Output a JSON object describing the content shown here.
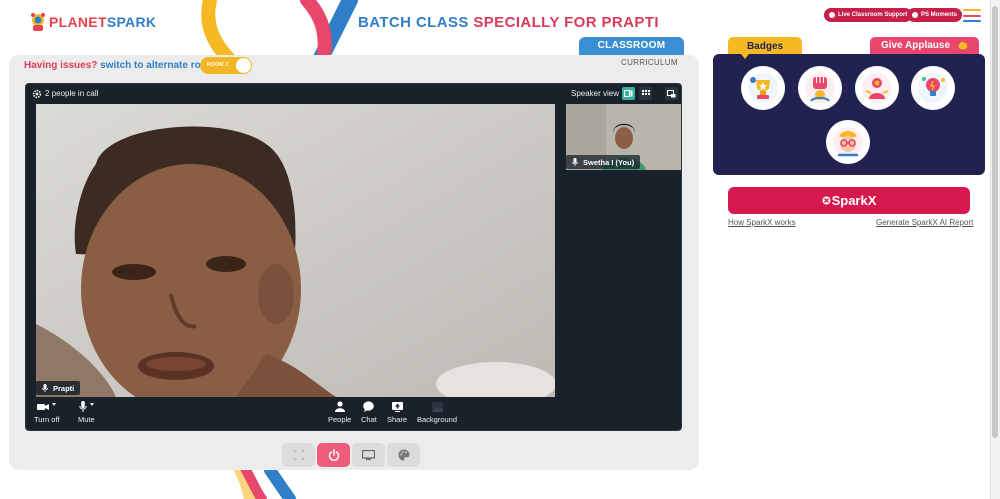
{
  "header": {
    "logo_text_a": "PLANET",
    "logo_text_b": "SPARK",
    "title_a": "BATCH CLASS",
    "title_b": "SPECIALLY FOR PRAPTI",
    "support_pill": "Live Classroom Support",
    "moments_pill": "PS Moments"
  },
  "classroom": {
    "issues_text": "Having issues?",
    "switch_text": "switch to alternate room",
    "room_toggle_label": "ROOM 2",
    "tab_classroom": "CLASSROOM",
    "tab_curriculum": "CURRICULUM"
  },
  "call": {
    "people_count": "2 people in call",
    "speaker_view_label": "Speaker view",
    "main_participant": "Prapti",
    "self_participant": "Swetha I (You)",
    "controls": {
      "camera": "Turn off",
      "mic": "Mute",
      "people": "People",
      "chat": "Chat",
      "share": "Share",
      "background": "Background"
    }
  },
  "right_panel": {
    "badges_tab": "Badges",
    "applause_tab": "Give Applause",
    "sparkx_button": "SparkX",
    "how_link": "How SparkX works",
    "report_link": "Generate SparkX AI Report"
  },
  "colors": {
    "brand_red": "#d7184f",
    "brand_blue": "#2f7fc9",
    "badge_panel": "#212250",
    "badges_yellow": "#f6b924",
    "call_bg": "#19222b",
    "speaker_view_active": "#35b3a0"
  }
}
